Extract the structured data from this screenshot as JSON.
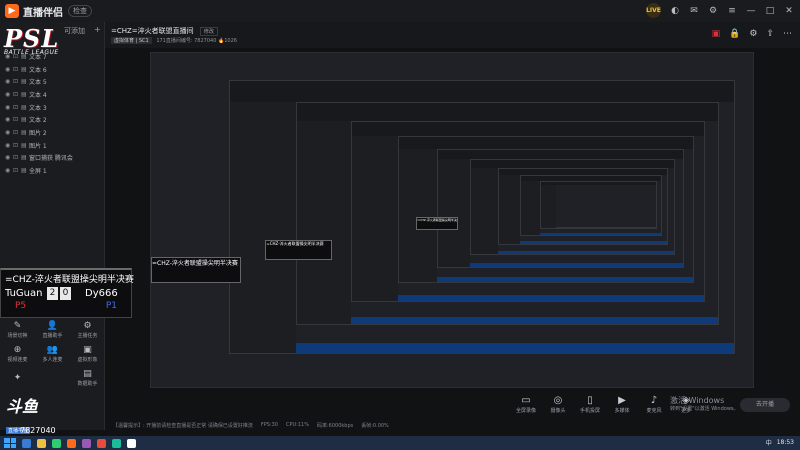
{
  "app": {
    "title": "直播伴侣",
    "version": "检查"
  },
  "topbar": {
    "avatar": "LIVE",
    "icons": [
      "skin-icon",
      "message-icon",
      "settings-icon",
      "menu-icon",
      "minimize-icon",
      "maximize-icon",
      "close-icon"
    ]
  },
  "sidebar": {
    "logo_main": "PSL",
    "logo_sub": "BATTLE LEAGUE",
    "add_label": "可添加",
    "more": "+",
    "layers": [
      {
        "label": "文本 7"
      },
      {
        "label": "文本 6"
      },
      {
        "label": "文本 5"
      },
      {
        "label": "文本 4"
      },
      {
        "label": "文本 3"
      },
      {
        "label": "文本 2"
      },
      {
        "label": "图片 2"
      },
      {
        "label": "图片 1"
      },
      {
        "label": "窗口捕获  腾讯会"
      },
      {
        "label": "全屏 1"
      }
    ]
  },
  "scoreboard": {
    "title": "=CHZ-淬火者联盟操尖明半决赛",
    "team1": "TuGuan",
    "score1": "2",
    "score2": "0",
    "team2": "Dy666",
    "tag1": "P5",
    "tag2": "P1"
  },
  "tools": [
    {
      "icon": "✎",
      "label": "场景切换"
    },
    {
      "icon": "👤",
      "label": "直播助手"
    },
    {
      "icon": "⚙",
      "label": "主播任务"
    },
    {
      "icon": "⊕",
      "label": "视频连麦"
    },
    {
      "icon": "👥",
      "label": "多人连麦"
    },
    {
      "icon": "▣",
      "label": "虚拟形象"
    },
    {
      "icon": "✦",
      "label": ""
    },
    {
      "icon": "",
      "label": ""
    },
    {
      "icon": "▤",
      "label": "数据助手"
    }
  ],
  "douyu": {
    "main": "斗鱼",
    "sub": "直播平台"
  },
  "room_id": "7827040",
  "main": {
    "room_title": "=CHZ=淬火者联盟直播间",
    "edit": "修改",
    "category": "虚拟体育 | SC1",
    "meta": "171直播间编号: 7827040   🔥1026",
    "head_icons": [
      "pc-icon",
      "lock-icon",
      "settings-icon",
      "share-icon",
      "more-icon"
    ]
  },
  "controls": [
    {
      "icon": "▭",
      "label": "全屏录像"
    },
    {
      "icon": "◎",
      "label": "摄像头"
    },
    {
      "icon": "▯",
      "label": "手机投屏"
    },
    {
      "icon": "▶",
      "label": "多媒体"
    },
    {
      "icon": "♪",
      "label": "麦克风"
    },
    {
      "icon": "◈",
      "label": "更多"
    }
  ],
  "activate": {
    "line1": "激活 Windows",
    "line2": "转到\"设置\"以激活 Windows。"
  },
  "go_live": "去开播",
  "status": [
    "【温馨提示】: 开播前请检查直播是否正常 请确保已设置好推流",
    "FPS:30",
    "CPU:11%",
    "码率:6000kbps",
    "丢帧:0.00%"
  ],
  "taskbar": {
    "time": "18:53",
    "lang": "中",
    "icons": [
      "#3a7bd5",
      "#f0c040",
      "#2ecc71",
      "#ff6a1a",
      "#9b59b6",
      "#e74c3c",
      "#1abc9c",
      "#ffffff"
    ]
  }
}
